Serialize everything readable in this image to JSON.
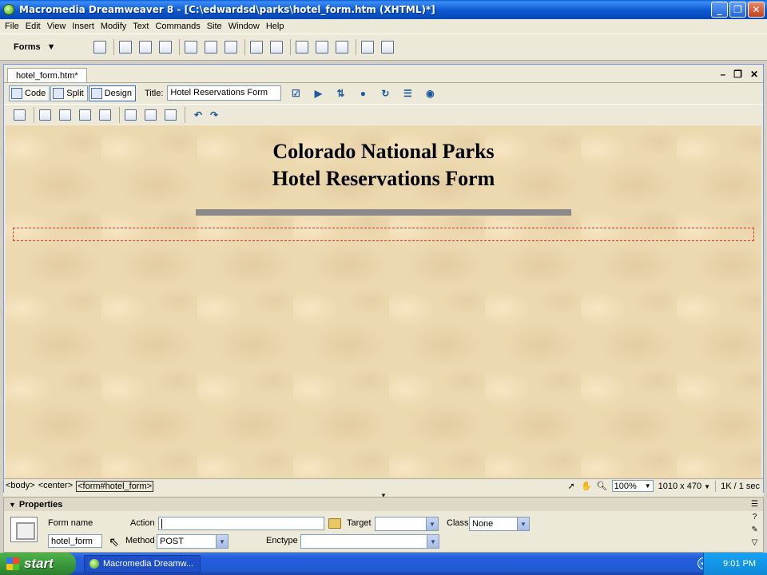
{
  "window": {
    "title": "Macromedia Dreamweaver 8 - [C:\\edwardsd\\parks\\hotel_form.htm (XHTML)*]"
  },
  "menu": [
    "File",
    "Edit",
    "View",
    "Insert",
    "Modify",
    "Text",
    "Commands",
    "Site",
    "Window",
    "Help"
  ],
  "insert_bar": {
    "category": "Forms"
  },
  "document": {
    "tab": "hotel_form.htm*",
    "view_buttons": {
      "code": "Code",
      "split": "Split",
      "design": "Design"
    },
    "title_label": "Title:",
    "title_value": "Hotel Reservations Form",
    "heading_line1": "Colorado National Parks",
    "heading_line2": "Hotel Reservations Form"
  },
  "status_bar": {
    "tags": [
      "<body>",
      "<center>",
      "<form#hotel_form>"
    ],
    "zoom": "100%",
    "size": "1010 x 470",
    "download": "1K / 1 sec"
  },
  "properties": {
    "header": "Properties",
    "form_name_label": "Form name",
    "form_name_value": "hotel_form",
    "action_label": "Action",
    "action_value": "",
    "target_label": "Target",
    "target_value": "",
    "class_label": "Class",
    "class_value": "None",
    "method_label": "Method",
    "method_value": "POST",
    "enctype_label": "Enctype",
    "enctype_value": ""
  },
  "taskbar": {
    "start_label": "start",
    "task_item": "Macromedia Dreamw...",
    "clock": "9:01 PM"
  },
  "colors": {
    "canvas_bg": "#edd9b0",
    "form_outline": "#e03030",
    "rule": "#8a8a8a"
  }
}
